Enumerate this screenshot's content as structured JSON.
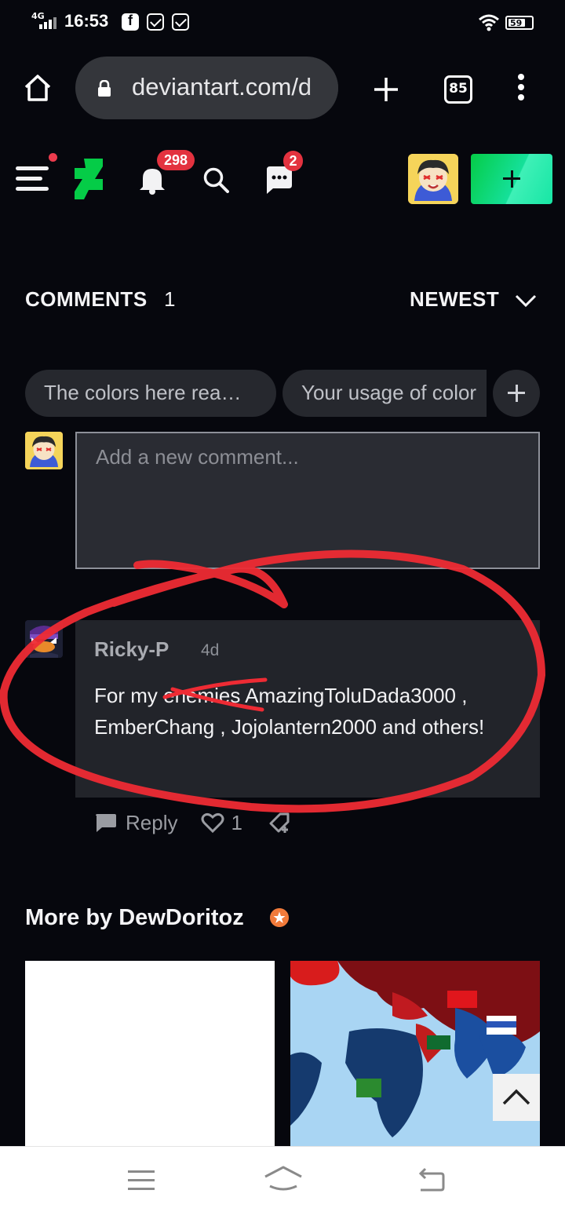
{
  "status_bar": {
    "network": "4G",
    "time": "16:53",
    "battery": "59"
  },
  "browser": {
    "url": "deviantart.com/d",
    "tab_count": "85"
  },
  "header": {
    "notifications_count": "298",
    "messages_count": "2",
    "accent_color": "#05cc47"
  },
  "comments": {
    "title": "COMMENTS",
    "count": "1",
    "sort_label": "NEWEST",
    "suggestions": [
      "The colors here rea…",
      "Your usage of color"
    ],
    "input_placeholder": "Add a new comment...",
    "items": [
      {
        "author": "Ricky-P",
        "time": "4d",
        "body": "For my enemies AmazingToluDada3000 , EmberChang , Jojolantern2000 and others!",
        "reply_label": "Reply",
        "likes": "1"
      }
    ]
  },
  "more_by": {
    "label": "More by DewDoritoz"
  },
  "icons": {
    "home": "home-icon",
    "lock": "lock-icon",
    "new_tab": "plus-icon",
    "tabs": "tabs-icon",
    "menu": "more-vertical-icon",
    "search": "search-icon",
    "bell": "bell-icon",
    "chat": "chat-icon"
  }
}
